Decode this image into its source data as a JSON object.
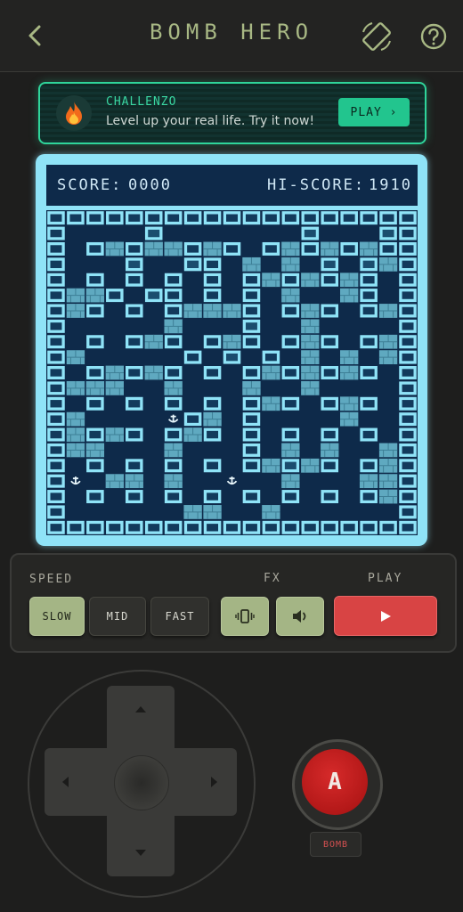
{
  "header": {
    "title": "BOMB HERO"
  },
  "banner": {
    "brand": "CHALLENZO",
    "text": "Level up your real life. Try it now!",
    "play_label": "PLAY ›"
  },
  "scoreboard": {
    "score_label": "SCORE:",
    "score": "0000",
    "hi_label": "HI-SCORE:",
    "hi_score": "1910"
  },
  "grid": {
    "legend": {
      "#": "wall",
      ".": "empty",
      "B": "brick",
      "X": "destructible-block",
      "E": "enemy"
    },
    "rows": [
      "###################",
      "#....X.......X...X#",
      "#.#B#BB#B#.#B#B#B##",
      "#...X..X#.B.B.X.XB#",
      "#.#.#.#.#.#B#B#B#.#",
      "#BB#.X#.#.#.B..B#.#",
      "#B#.#.#BBB#.#B#.#B#",
      "#.....B...X..B....#",
      "#.#.#B#.#B#.#B#.#B#",
      "#B.....#.X.#.B.B.B#",
      "#.#B#B#.#.#B#B#B#.#",
      "#BBB..B...B..B....#",
      "#.#.#.#.#.#B#.#B#.#",
      "#B....E#B.#....B..#",
      "#B#B#.#B#.#.#.#.#.#",
      "#BB...B...#.B.B..B#",
      "#.#.#.#.#.#BXB#.#B#",
      "#E.BB.B..E..B...BB#",
      "#.#.#.#.#.#.#.#.#B#",
      "#......BB..B......#",
      "###################"
    ]
  },
  "controls": {
    "speed_label": "SPEED",
    "fx_label": "FX",
    "play_label": "PLAY",
    "speed_options": [
      {
        "label": "SLOW",
        "selected": true
      },
      {
        "label": "MID",
        "selected": false
      },
      {
        "label": "FAST",
        "selected": false
      }
    ],
    "fx_icons": [
      "vibrate-icon",
      "volume-icon"
    ]
  },
  "gamepad": {
    "a_label": "A",
    "bomb_label": "BOMB"
  },
  "colors": {
    "background": "#1e1e1d",
    "banner_accent": "#2fd49a",
    "board_frame": "#8fe3f7",
    "board_bg": "#0e2a4a",
    "wall": "#8fe3f7",
    "brick": "#5fa9c0",
    "selected_btn": "#a4b585",
    "play_red": "#d84444",
    "a_red": "#c21f1f"
  }
}
